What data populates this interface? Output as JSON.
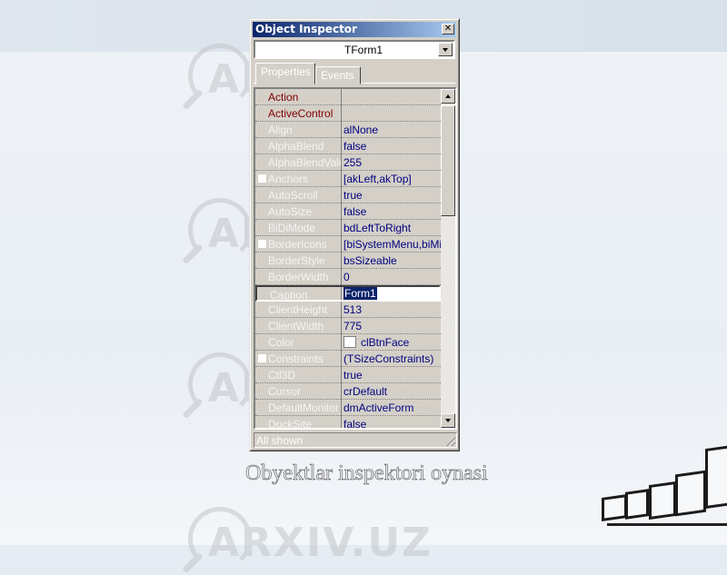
{
  "window": {
    "title": "Object Inspector",
    "close_icon": "close-icon",
    "selected_object": "TForm1",
    "tabs": [
      {
        "label": "Properties",
        "active": true
      },
      {
        "label": "Events",
        "active": false
      }
    ],
    "properties": [
      {
        "name": "Action",
        "value": "",
        "kind": "event",
        "expandable": false
      },
      {
        "name": "ActiveControl",
        "value": "",
        "kind": "event",
        "expandable": false
      },
      {
        "name": "Align",
        "value": "alNone",
        "expandable": false
      },
      {
        "name": "AlphaBlend",
        "value": "false",
        "expandable": false
      },
      {
        "name": "AlphaBlendValue",
        "value": "255",
        "expandable": false
      },
      {
        "name": "Anchors",
        "value": "[akLeft,akTop]",
        "expandable": true
      },
      {
        "name": "AutoScroll",
        "value": "true",
        "expandable": false
      },
      {
        "name": "AutoSize",
        "value": "false",
        "expandable": false
      },
      {
        "name": "BiDiMode",
        "value": "bdLeftToRight",
        "expandable": false
      },
      {
        "name": "BorderIcons",
        "value": "[biSystemMenu,biMinimize,biMaximize]",
        "expandable": true
      },
      {
        "name": "BorderStyle",
        "value": "bsSizeable",
        "expandable": false
      },
      {
        "name": "BorderWidth",
        "value": "0",
        "expandable": false
      },
      {
        "name": "Caption",
        "value": "Form1",
        "expandable": false,
        "selected": true
      },
      {
        "name": "ClientHeight",
        "value": "513",
        "expandable": false
      },
      {
        "name": "ClientWidth",
        "value": "775",
        "expandable": false
      },
      {
        "name": "Color",
        "value": "clBtnFace",
        "expandable": false,
        "swatch": "#ffffff"
      },
      {
        "name": "Constraints",
        "value": "(TSizeConstraints)",
        "expandable": true
      },
      {
        "name": "Ctl3D",
        "value": "true",
        "expandable": false
      },
      {
        "name": "Cursor",
        "value": "crDefault",
        "expandable": false
      },
      {
        "name": "DefaultMonitor",
        "value": "dmActiveForm",
        "expandable": false
      },
      {
        "name": "DockSite",
        "value": "false",
        "expandable": false
      }
    ],
    "status": "All shown",
    "scrollbar": {
      "thumb_position_fraction": 0.0,
      "visible_fraction": 0.35
    }
  },
  "caption": "Obyektlar inspektori oynasi",
  "watermark": "ARXIV.UZ",
  "colors": {
    "titlebar_start": "#0a246a",
    "titlebar_end": "#a6caf0",
    "value_text": "#000080",
    "event_text": "#800000",
    "face": "#d4d0c8"
  }
}
